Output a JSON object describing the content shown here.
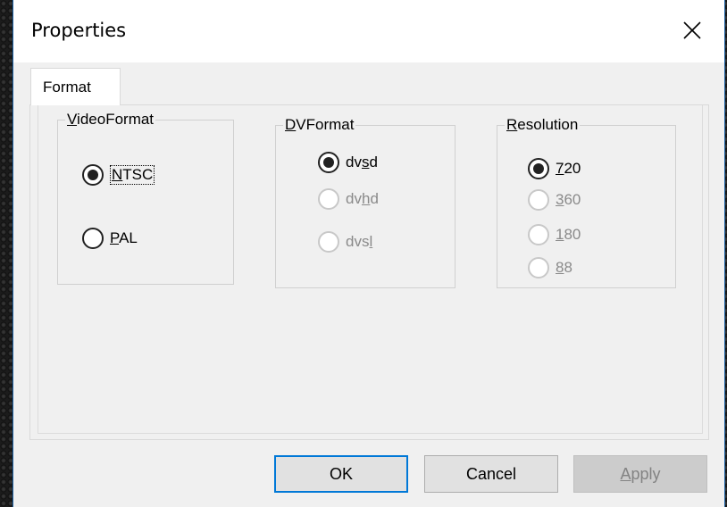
{
  "window": {
    "title": "Properties",
    "close_label": "×"
  },
  "tabs": [
    {
      "label": "Format",
      "active": true
    }
  ],
  "groups": {
    "video_format": {
      "label_underlined": "V",
      "label_rest": "ideoFormat",
      "options": [
        {
          "pre": "",
          "ul": "N",
          "post": "TSC",
          "selected": true,
          "enabled": true
        },
        {
          "pre": "",
          "ul": "P",
          "post": "AL",
          "selected": false,
          "enabled": true
        }
      ]
    },
    "dv_format": {
      "label_underlined": "D",
      "label_rest": "VFormat",
      "options": [
        {
          "pre": "dv",
          "ul": "s",
          "post": "d",
          "selected": true,
          "enabled": true
        },
        {
          "pre": "dv",
          "ul": "h",
          "post": "d",
          "selected": false,
          "enabled": false
        },
        {
          "pre": "dvs",
          "ul": "l",
          "post": "",
          "selected": false,
          "enabled": false
        }
      ]
    },
    "resolution": {
      "label_underlined": "R",
      "label_rest": "esolution",
      "options": [
        {
          "pre": "",
          "ul": "7",
          "post": "20",
          "selected": true,
          "enabled": true
        },
        {
          "pre": "",
          "ul": "3",
          "post": "60",
          "selected": false,
          "enabled": false
        },
        {
          "pre": "",
          "ul": "1",
          "post": "80",
          "selected": false,
          "enabled": false
        },
        {
          "pre": "",
          "ul": "8",
          "post": "8",
          "selected": false,
          "enabled": false
        }
      ]
    }
  },
  "buttons": {
    "ok": "OK",
    "cancel": "Cancel",
    "apply_ul": "A",
    "apply_rest": "pply"
  },
  "colors": {
    "accent": "#0078d7",
    "dialog_bg": "#f0f0f0",
    "disabled_text": "#8a8a8a"
  }
}
